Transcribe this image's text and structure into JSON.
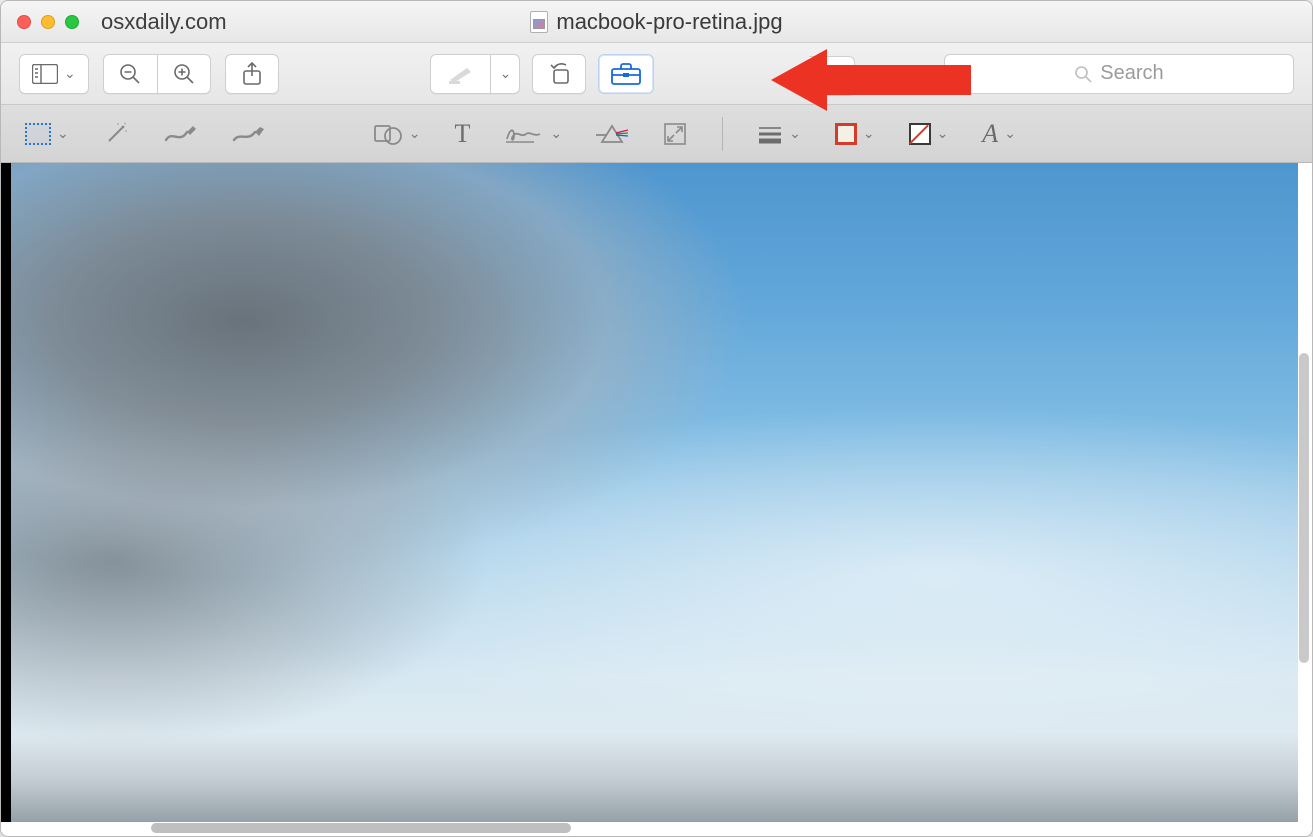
{
  "window": {
    "site_label": "osxdaily.com",
    "file_name": "macbook-pro-retina.jpg"
  },
  "toolbar": {
    "search_placeholder": "Search"
  },
  "icons": {
    "sidebar": "sidebar-icon",
    "zoom_out": "zoom-out-icon",
    "zoom_in": "zoom-in-icon",
    "share": "share-icon",
    "highlight": "highlight-icon",
    "rotate": "rotate-left-icon",
    "markup": "toolbox-icon",
    "search": "magnifier-icon"
  },
  "markup": {
    "tools": {
      "selection": "rectangular-selection",
      "instant_alpha": "instant-alpha-wand",
      "draw": "sketch-pencil",
      "sketch": "draw-brush",
      "shapes": "shapes",
      "text": "T",
      "sign": "signature",
      "adjust_color": "adjust-color-prism",
      "adjust_size": "adjust-size",
      "line_style": "line-weight",
      "border_color": "border-color",
      "fill_color": "fill-color",
      "text_style": "A"
    }
  },
  "colors": {
    "accent_blue": "#1569df",
    "annotation_red": "#ec3323",
    "border_swatch": "#d23c2a"
  }
}
